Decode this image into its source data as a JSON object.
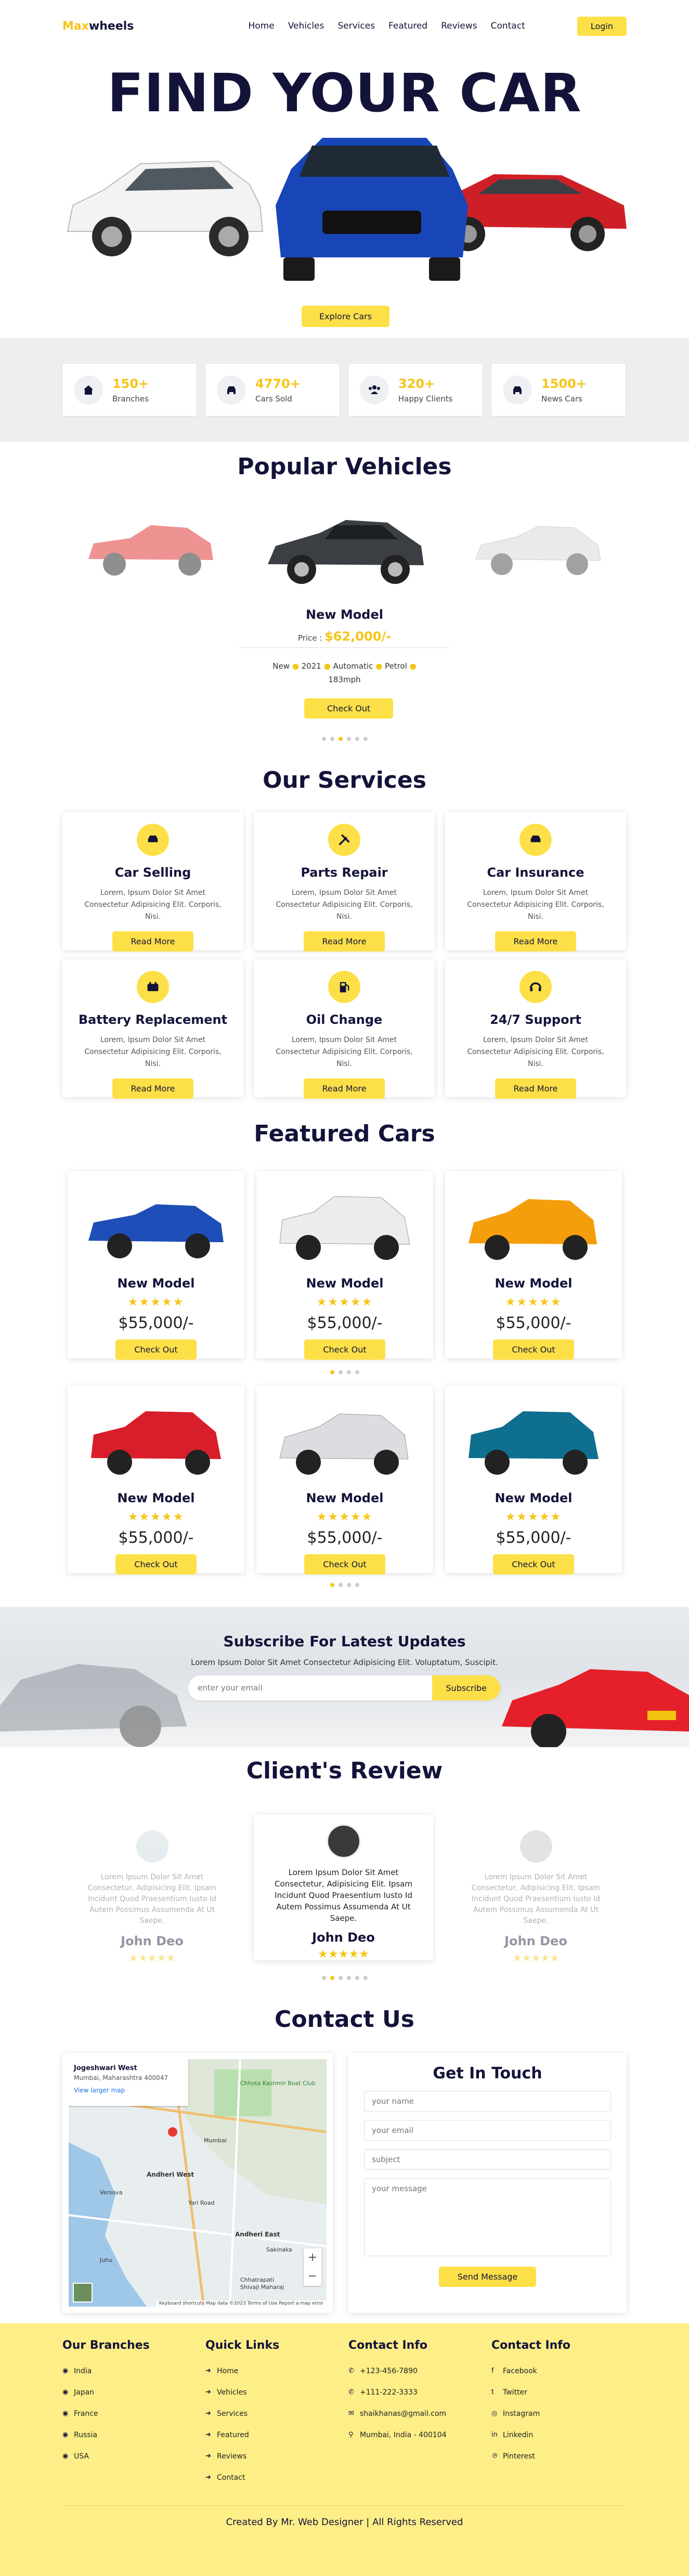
{
  "header": {
    "logo_accent": "Max",
    "logo_rest": "wheels",
    "nav": [
      "Home",
      "Vehicles",
      "Services",
      "Featured",
      "Reviews",
      "Contact"
    ],
    "login": "Login"
  },
  "hero": {
    "title": "FIND YOUR CAR",
    "button": "Explore Cars"
  },
  "stats": [
    {
      "num": "150+",
      "label": "Branches",
      "icon": "home-icon"
    },
    {
      "num": "4770+",
      "label": "Cars Sold",
      "icon": "car-icon"
    },
    {
      "num": "320+",
      "label": "Happy Clients",
      "icon": "users-icon"
    },
    {
      "num": "1500+",
      "label": "News Cars",
      "icon": "car-icon"
    }
  ],
  "popular": {
    "title": "Popular Vehicles",
    "model": "New Model",
    "price_label": "Price :",
    "price": "$62,000/-",
    "specs": [
      "New",
      "2021",
      "Automatic",
      "Petrol",
      "183mph"
    ],
    "button": "Check Out"
  },
  "services": {
    "title": "Our Services",
    "items": [
      {
        "name": "Car Selling",
        "text": "Lorem, Ipsum Dolor Sit Amet Consectetur Adipisicing Elit. Corporis, Nisi.",
        "button": "Read More",
        "icon": "car-icon"
      },
      {
        "name": "Parts Repair",
        "text": "Lorem, Ipsum Dolor Sit Amet Consectetur Adipisicing Elit. Corporis, Nisi.",
        "button": "Read More",
        "icon": "tools-icon"
      },
      {
        "name": "Car Insurance",
        "text": "Lorem, Ipsum Dolor Sit Amet Consectetur Adipisicing Elit. Corporis, Nisi.",
        "button": "Read More",
        "icon": "car-icon"
      },
      {
        "name": "Battery Replacement",
        "text": "Lorem, Ipsum Dolor Sit Amet Consectetur Adipisicing Elit. Corporis, Nisi.",
        "button": "Read More",
        "icon": "battery-icon"
      },
      {
        "name": "Oil Change",
        "text": "Lorem, Ipsum Dolor Sit Amet Consectetur Adipisicing Elit. Corporis, Nisi.",
        "button": "Read More",
        "icon": "gas-pump-icon"
      },
      {
        "name": "24/7 Support",
        "text": "Lorem, Ipsum Dolor Sit Amet Consectetur Adipisicing Elit. Corporis, Nisi.",
        "button": "Read More",
        "icon": "headset-icon"
      }
    ]
  },
  "featured": {
    "title": "Featured Cars",
    "cards": [
      {
        "model": "New Model",
        "price": "$55,000/-",
        "button": "Check Out",
        "color": "#1e4fb8"
      },
      {
        "model": "New Model",
        "price": "$55,000/-",
        "button": "Check Out",
        "color": "#e8e8ea"
      },
      {
        "model": "New Model",
        "price": "$55,000/-",
        "button": "Check Out",
        "color": "#f59e0b"
      },
      {
        "model": "New Model",
        "price": "$55,000/-",
        "button": "Check Out",
        "color": "#d91e2b"
      },
      {
        "model": "New Model",
        "price": "$55,000/-",
        "button": "Check Out",
        "color": "#dcdde0"
      },
      {
        "model": "New Model",
        "price": "$55,000/-",
        "button": "Check Out",
        "color": "#0f6f8f"
      }
    ]
  },
  "subscribe": {
    "title": "Subscribe For Latest Updates",
    "text": "Lorem Ipsum Dolor Sit Amet Consectetur Adipisicing Elit. Voluptatum, Suscipit.",
    "placeholder": "enter your email",
    "button": "Subscribe"
  },
  "reviews": {
    "title": "Client's Review",
    "items": [
      {
        "text": "Lorem Ipsum Dolor Sit Amet Consectetur, Adipisicing Elit. Ipsam Incidunt Quod Praesentium Iusto Id Autem Possimus Assumenda At Ut Saepe.",
        "name": "John Deo"
      },
      {
        "text": "Lorem Ipsum Dolor Sit Amet Consectetur, Adipisicing Elit. Ipsam Incidunt Quod Praesentium Iusto Id Autem Possimus Assumenda At Ut Saepe.",
        "name": "John Deo"
      },
      {
        "text": "Lorem Ipsum Dolor Sit Amet Consectetur, Adipisicing Elit. Ipsam Incidunt Quod Praesentium Iusto Id Autem Possimus Assumenda At Ut Saepe.",
        "name": "John Deo"
      }
    ]
  },
  "contact": {
    "title": "Contact Us",
    "map": {
      "place": "Jogeshwari West",
      "address": "Mumbai, Maharashtra 400047",
      "link": "View larger map",
      "labels": [
        "Chhota Kashmir Boat Club",
        "Andheri West",
        "Andheri East",
        "Mumbai",
        "Chhatrapati",
        "Shivaji Maharaj",
        "Juhu",
        "Sakinaka",
        "Yari Road",
        "Versova"
      ],
      "footer": "Keyboard shortcuts  Map data ©2023  Terms of Use  Report a map error"
    },
    "form_title": "Get In Touch",
    "name_ph": "your name",
    "email_ph": "your email",
    "subject_ph": "subject",
    "message_ph": "your message",
    "button": "Send Message"
  },
  "footer": {
    "branches": {
      "title": "Our Branches",
      "items": [
        "India",
        "Japan",
        "France",
        "Russia",
        "USA"
      ]
    },
    "links": {
      "title": "Quick Links",
      "items": [
        "Home",
        "Vehicles",
        "Services",
        "Featured",
        "Reviews",
        "Contact"
      ]
    },
    "info": {
      "title": "Contact Info",
      "items": [
        "+123-456-7890",
        "+111-222-3333",
        "shaikhanas@gmail.com",
        "Mumbai, India - 400104"
      ]
    },
    "social": {
      "title": "Contact Info",
      "items": [
        "Facebook",
        "Twitter",
        "Instagram",
        "Linkedin",
        "Pinterest"
      ]
    },
    "credit": "Created By Mr. Web Designer | All Rights Reserved"
  },
  "colors": {
    "accent": "#fde047",
    "accent_text": "#f5c518",
    "navy": "#13133a"
  }
}
